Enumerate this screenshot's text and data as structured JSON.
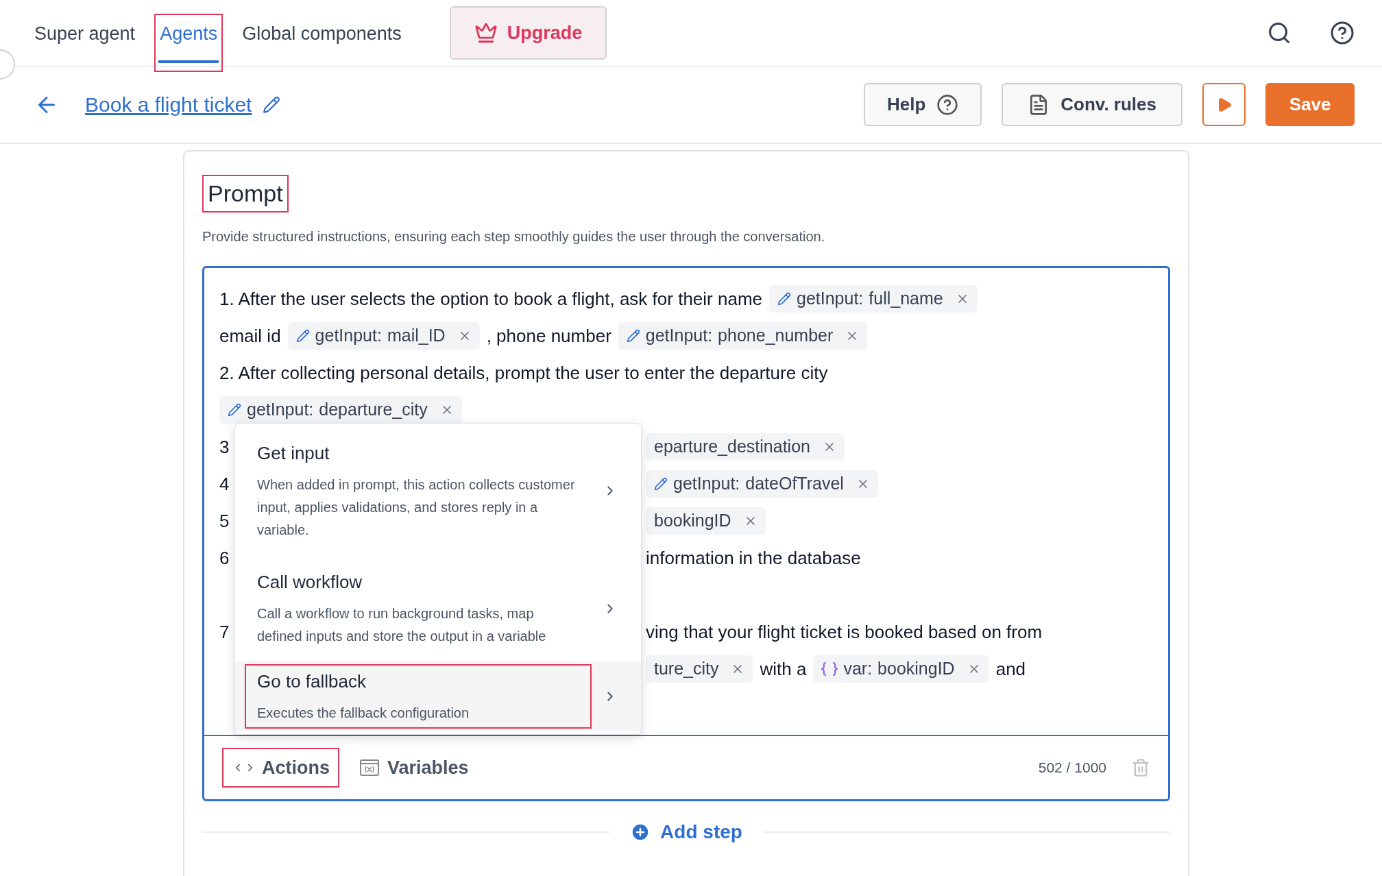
{
  "nav": {
    "tabs": [
      {
        "label": "Super agent",
        "selected": false,
        "highlighted": false
      },
      {
        "label": "Agents",
        "selected": true,
        "highlighted": true
      },
      {
        "label": "Global components",
        "selected": false,
        "highlighted": false
      }
    ],
    "upgrade": "Upgrade"
  },
  "header": {
    "title": "Book a flight ticket",
    "help": "Help",
    "conv_rules": "Conv. rules",
    "save": "Save"
  },
  "prompt": {
    "title": "Prompt",
    "title_highlighted": true,
    "description": "Provide structured instructions, ensuring each step smoothly guides the user through the conversation.",
    "lines": [
      {
        "segments": [
          {
            "kind": "text",
            "text": "1. After the user selects the option to book a flight, ask for their name"
          },
          {
            "kind": "input",
            "label": "getInput:",
            "value": "full_name"
          }
        ]
      },
      {
        "segments": [
          {
            "kind": "text",
            "text": "email id"
          },
          {
            "kind": "input",
            "label": "getInput:",
            "value": "mail_ID"
          },
          {
            "kind": "text",
            "text": ", phone number"
          },
          {
            "kind": "input",
            "label": "getInput:",
            "value": "phone_number"
          }
        ]
      },
      {
        "segments": [
          {
            "kind": "text",
            "text": "2. After collecting personal details, prompt the user to enter the departure city"
          }
        ]
      },
      {
        "segments": [
          {
            "kind": "input",
            "label": "getInput:",
            "value": "departure_city"
          }
        ]
      }
    ],
    "beside_menu_upper": [
      {
        "lead": "3",
        "segments": [
          {
            "kind": "plain",
            "value": "eparture_destination"
          }
        ]
      },
      {
        "lead": "4",
        "segments": [
          {
            "kind": "input",
            "label": "getInput:",
            "value": "dateOfTravel"
          }
        ]
      },
      {
        "lead": "5",
        "segments": [
          {
            "kind": "plain",
            "value": "bookingID"
          }
        ]
      },
      {
        "lead": "6",
        "segments": [
          {
            "kind": "text",
            "text": "information in the database"
          }
        ]
      }
    ],
    "beside_menu_lower": [
      {
        "lead": "7",
        "segments": [
          {
            "kind": "text",
            "text": "ving that your flight ticket is booked based on from"
          }
        ]
      },
      {
        "segments": [
          {
            "kind": "plain",
            "value": "ture_city"
          },
          {
            "kind": "text",
            "text": "with a"
          },
          {
            "kind": "variable",
            "label": "var:",
            "value": "bookingID"
          },
          {
            "kind": "text",
            "text": "and"
          }
        ]
      }
    ],
    "menu": [
      {
        "title": "Get input",
        "description": "When added in prompt, this action collects customer input, applies validations, and stores reply in a variable.",
        "selected": false,
        "highlighted": false
      },
      {
        "title": "Call workflow",
        "description": "Call a workflow to run background tasks, map defined inputs and store the output in a variable",
        "selected": false,
        "highlighted": false
      },
      {
        "title": "Go to fallback",
        "description": "Executes the fallback configuration",
        "selected": true,
        "highlighted": true
      }
    ],
    "actions": {
      "label": "Actions",
      "highlighted": true
    },
    "variables": "Variables",
    "counter": "502 / 1000"
  },
  "add_step": "Add step"
}
